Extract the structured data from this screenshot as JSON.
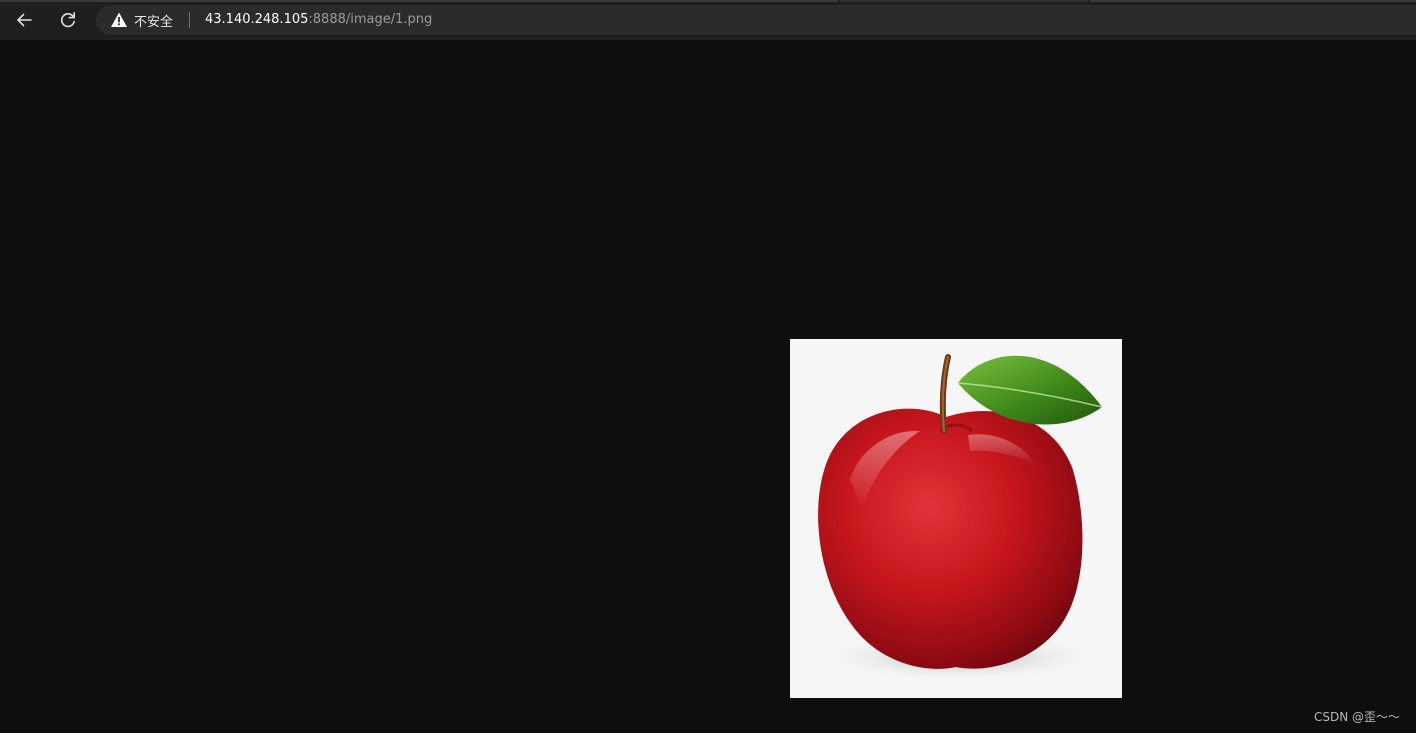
{
  "browser": {
    "security": {
      "icon": "warning-icon",
      "label": "不安全"
    },
    "url": {
      "host": "43.140.248.105",
      "rest": ":8888/image/1.png"
    },
    "nav": {
      "back_icon": "back-arrow-icon",
      "reload_icon": "reload-icon"
    }
  },
  "colors": {
    "page_background": "#0e0e0e",
    "toolbar_background": "#1f1f1f",
    "omnibox_background": "#2b2b2b",
    "image_background": "#f6f6f6",
    "apple_red": "#c8161d",
    "leaf_green": "#3f8a1a"
  },
  "content": {
    "image_subject": "red-apple-with-leaf"
  },
  "watermark": {
    "text": "CSDN @歪～～"
  }
}
